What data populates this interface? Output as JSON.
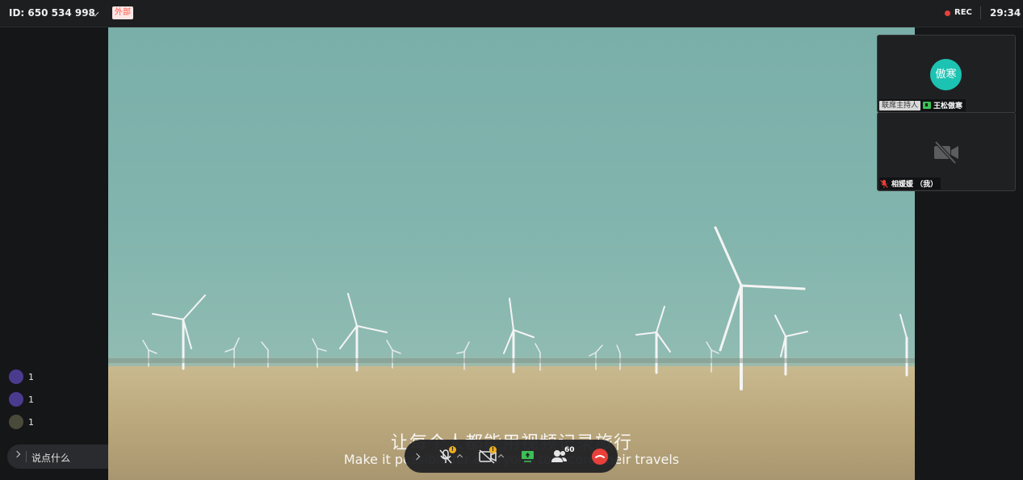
{
  "header": {
    "meeting_id": "ID: 650 534 998",
    "external_badge": "外部",
    "rec_label": "REC",
    "timer": "29:34"
  },
  "video": {
    "subtitle_cn": "让每个人都能用视频记录旅行",
    "subtitle_en": "Make it possible for everyone to record their travels"
  },
  "participants": [
    {
      "avatar_text": "傲寒",
      "role_badge": "联席主持人",
      "name": "王松傲寒",
      "sharing": true
    },
    {
      "name": "相媛媛 （我）",
      "camera": "off",
      "mic": "muted"
    }
  ],
  "reactions": [
    {
      "avatar": "purple",
      "count": "1"
    },
    {
      "avatar": "purple",
      "count": "1"
    },
    {
      "avatar": "photo",
      "count": "1"
    }
  ],
  "chat": {
    "placeholder": "说点什么"
  },
  "controls": {
    "participants_count": "60",
    "mic_warning": "!",
    "camera_warning": "!"
  },
  "colors": {
    "accent": "#1dc3b2",
    "rec": "#e8403a",
    "share": "#3cbf57",
    "warning": "#f2b01e"
  }
}
